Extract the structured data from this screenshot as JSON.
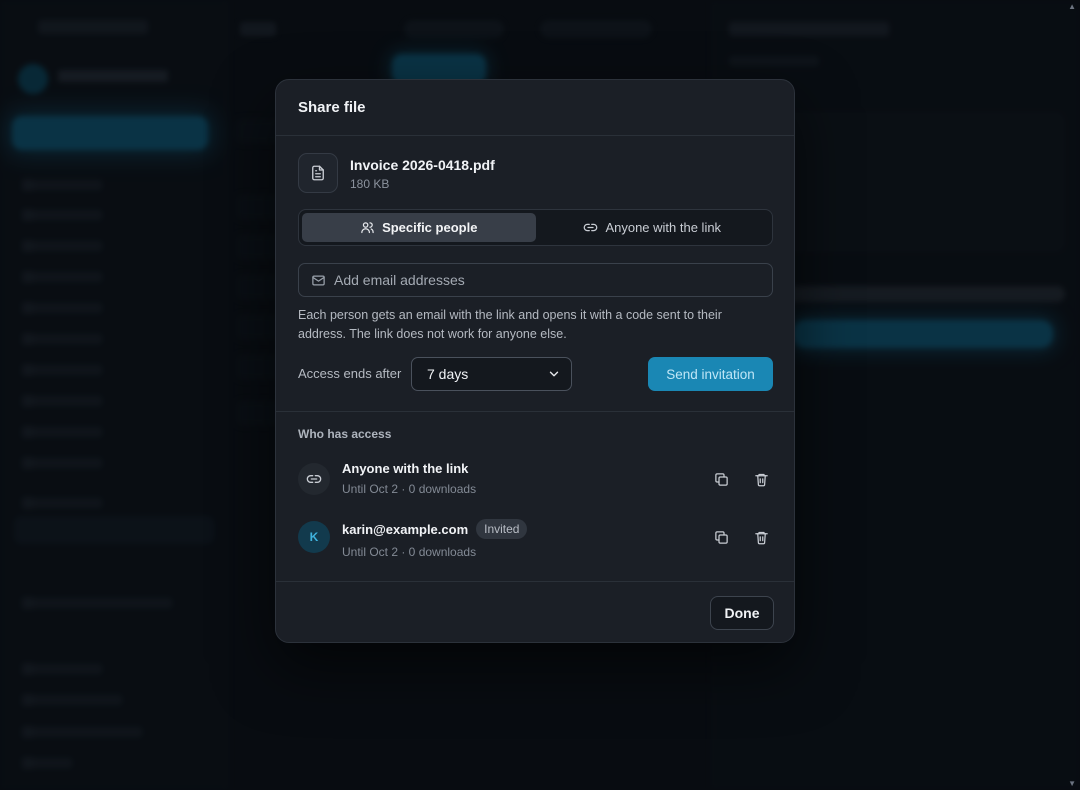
{
  "modal": {
    "title": "Share file",
    "file": {
      "name": "Invoice 2026-0418.pdf",
      "size": "180 KB",
      "icon": "document-icon"
    },
    "tabs": [
      {
        "label": "Specific people",
        "icon": "people-icon",
        "active": true
      },
      {
        "label": "Anyone with the link",
        "icon": "link-icon",
        "active": false
      }
    ],
    "email_input": {
      "placeholder": "Add email addresses",
      "value": "",
      "icon": "mail-icon"
    },
    "help_text": "Each person gets an email with the link and opens it with a code sent to their address. The link does not work for anyone else.",
    "access_ends": {
      "label": "Access ends after",
      "selected": "7 days"
    },
    "send_button": "Send invitation",
    "who_has_access_label": "Who has access",
    "access_list": [
      {
        "kind": "link",
        "title": "Anyone with the link",
        "subtitle": "Until Oct 2 · 0 downloads"
      },
      {
        "kind": "person",
        "initial": "K",
        "title": "karin@example.com",
        "badge": "Invited",
        "subtitle": "Until Oct 2 · 0 downloads"
      }
    ],
    "done_button": "Done"
  },
  "colors": {
    "accent": "#1a87b4",
    "modal_bg": "#1b1f26",
    "avatar_bg": "#123a4d",
    "avatar_text": "#3fb3de"
  }
}
